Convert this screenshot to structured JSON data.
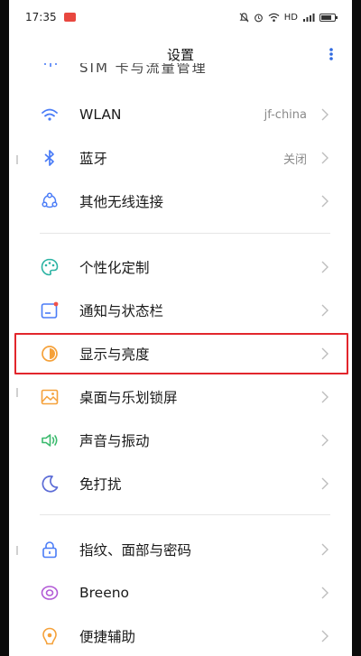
{
  "status_bar": {
    "time": "17:35",
    "network": "HD"
  },
  "header": {
    "title": "设置"
  },
  "partial_row": {
    "label": "SIM 卡与流量管理"
  },
  "settings": [
    {
      "id": "wlan",
      "label": "WLAN",
      "value": "jf-china",
      "icon": "wifi-icon",
      "color": "#4a7cf7"
    },
    {
      "id": "bluetooth",
      "label": "蓝牙",
      "value": "关闭",
      "icon": "bluetooth-icon",
      "color": "#4a7cf7"
    },
    {
      "id": "other-wireless",
      "label": "其他无线连接",
      "value": "",
      "icon": "connection-icon",
      "color": "#4a7cf7"
    },
    {
      "id": "personalize",
      "label": "个性化定制",
      "value": "",
      "icon": "palette-icon",
      "color": "#2bb3a3"
    },
    {
      "id": "notification",
      "label": "通知与状态栏",
      "value": "",
      "icon": "notification-icon",
      "color": "#4a7cf7"
    },
    {
      "id": "display",
      "label": "显示与亮度",
      "value": "",
      "icon": "brightness-icon",
      "color": "#f5a13a"
    },
    {
      "id": "wallpaper",
      "label": "桌面与乐划锁屏",
      "value": "",
      "icon": "wallpaper-icon",
      "color": "#f5a13a"
    },
    {
      "id": "sound",
      "label": "声音与振动",
      "value": "",
      "icon": "speaker-icon",
      "color": "#3aba6d"
    },
    {
      "id": "dnd",
      "label": "免打扰",
      "value": "",
      "icon": "moon-icon",
      "color": "#5b6bd6"
    },
    {
      "id": "security",
      "label": "指纹、面部与密码",
      "value": "",
      "icon": "lock-icon",
      "color": "#4a7cf7"
    },
    {
      "id": "breeno",
      "label": "Breeno",
      "value": "",
      "icon": "breeno-icon",
      "color": "#b25ad6"
    },
    {
      "id": "accessibility",
      "label": "便捷辅助",
      "value": "",
      "icon": "accessibility-icon",
      "color": "#f5a13a"
    }
  ],
  "highlighted_item": "display"
}
